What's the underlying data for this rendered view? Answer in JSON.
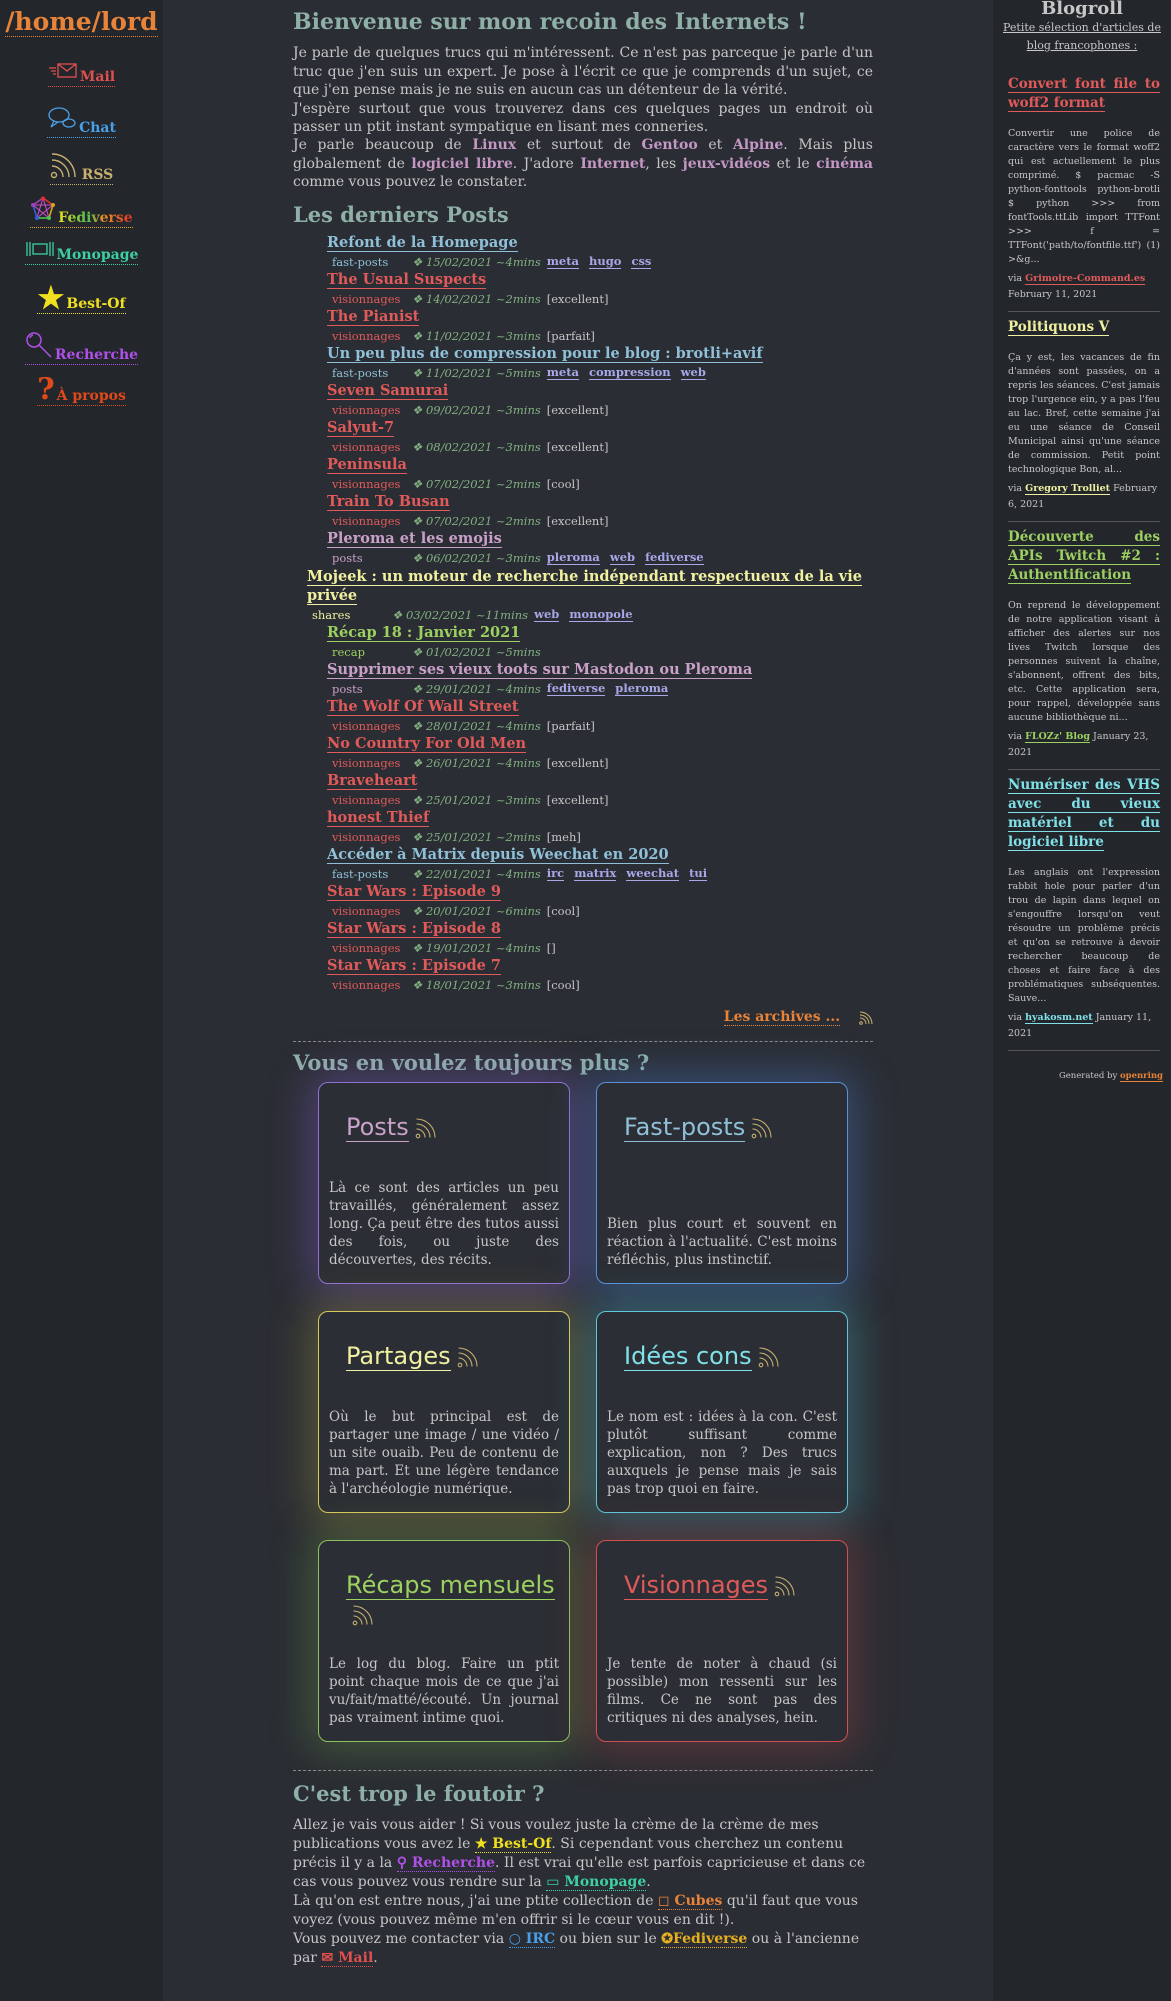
{
  "site": {
    "title": "/home/lord"
  },
  "nav": [
    {
      "label": "Mail",
      "color": "#e05050",
      "icon": "mail-icon"
    },
    {
      "label": "Chat",
      "color": "#4aa0e8",
      "icon": "chat-icon"
    },
    {
      "label": "RSS",
      "color": "#c8b070",
      "icon": "rss-icon"
    },
    {
      "label": "Fediverse",
      "color": "#e8b020",
      "icon": "fediverse-icon"
    },
    {
      "label": "Monopage",
      "color": "#3ed0a0",
      "icon": "monopage-icon"
    },
    {
      "label": "Best-Of",
      "color": "#f0e020",
      "icon": "star-icon"
    },
    {
      "label": "Recherche",
      "color": "#b050e8",
      "icon": "search-icon"
    },
    {
      "label": "À propos",
      "color": "#e04a1a",
      "icon": "question-icon"
    }
  ],
  "main": {
    "welcome_title": "Bienvenue sur mon recoin des Internets !",
    "intro": {
      "p1": "Je parle de quelques trucs qui m'intéressent. Ce n'est pas parceque je parle d'un truc que j'en suis un expert. Je pose à l'écrit ce que je comprends d'un sujet, ce que j'en pense mais je ne suis en aucun cas un détenteur de la vérité.",
      "p2": "J'espère surtout que vous trouverez dans ces quelques pages un endroit où passer un ptit instant sympatique en lisant mes conneries.",
      "p3_a": "Je parle beaucoup de ",
      "linux": "Linux",
      "p3_b": " et surtout de ",
      "gentoo": "Gentoo",
      "p3_c": " et ",
      "alpine": "Alpine",
      "p3_d": ". Mais plus globalement de ",
      "logiciel_libre": "logiciel libre",
      "p3_e": ". J'adore ",
      "internet": "Internet",
      "p3_f": ", les ",
      "jeux": "jeux-vidéos",
      "p3_g": " et le ",
      "cinema": "cinéma",
      "p3_h": " comme vous pouvez le constater."
    },
    "posts_title": "Les derniers Posts",
    "posts": [
      {
        "title": "Refont de la Homepage",
        "category": "fast-posts",
        "date": "❖ 15/02/2021 ~4mins",
        "tags": [
          "meta",
          "hugo",
          "css"
        ],
        "rating": "",
        "color": "#8fc0d8"
      },
      {
        "title": "The Usual Suspects",
        "category": "visionnages",
        "date": "❖ 14/02/2021 ~2mins",
        "tags": [],
        "rating": "[excellent]",
        "color": "#e05a5a"
      },
      {
        "title": "The Pianist",
        "category": "visionnages",
        "date": "❖ 11/02/2021 ~3mins",
        "tags": [],
        "rating": "[parfait]",
        "color": "#e05a5a"
      },
      {
        "title": "Un peu plus de compression pour le blog : brotli+avif",
        "category": "fast-posts",
        "date": "❖ 11/02/2021 ~5mins",
        "tags": [
          "meta",
          "compression",
          "web"
        ],
        "rating": "",
        "color": "#8fc0d8"
      },
      {
        "title": "Seven Samurai",
        "category": "visionnages",
        "date": "❖ 09/02/2021 ~3mins",
        "tags": [],
        "rating": "[excellent]",
        "color": "#e05a5a"
      },
      {
        "title": "Salyut-7",
        "category": "visionnages",
        "date": "❖ 08/02/2021 ~3mins",
        "tags": [],
        "rating": "[excellent]",
        "color": "#e05a5a"
      },
      {
        "title": "Peninsula",
        "category": "visionnages",
        "date": "❖ 07/02/2021 ~2mins",
        "tags": [],
        "rating": "[cool]",
        "color": "#e05a5a"
      },
      {
        "title": "Train To Busan",
        "category": "visionnages",
        "date": "❖ 07/02/2021 ~2mins",
        "tags": [],
        "rating": "[excellent]",
        "color": "#e05a5a"
      },
      {
        "title": "Pleroma et les emojis",
        "category": "posts",
        "date": "❖ 06/02/2021 ~3mins",
        "tags": [
          "pleroma",
          "web",
          "fediverse"
        ],
        "rating": "",
        "color": "#c8a0c8"
      },
      {
        "title": "Mojeek : un moteur de recherche indépendant respectueux de la vie privée",
        "category": "shares",
        "date": "❖ 03/02/2021 ~11mins",
        "tags": [
          "web",
          "monopole"
        ],
        "rating": "",
        "color": "#f0f0a0",
        "shares": true
      },
      {
        "title": "Récap 18 : Janvier 2021",
        "category": "recap",
        "date": "❖ 01/02/2021 ~5mins",
        "tags": [],
        "rating": "",
        "color": "#9cd060"
      },
      {
        "title": "Supprimer ses vieux toots sur Mastodon ou Pleroma",
        "category": "posts",
        "date": "❖ 29/01/2021 ~4mins",
        "tags": [
          "fediverse",
          "pleroma"
        ],
        "rating": "",
        "color": "#c8a0c8"
      },
      {
        "title": "The Wolf Of Wall Street",
        "category": "visionnages",
        "date": "❖ 28/01/2021 ~4mins",
        "tags": [],
        "rating": "[parfait]",
        "color": "#e05a5a"
      },
      {
        "title": "No Country For Old Men",
        "category": "visionnages",
        "date": "❖ 26/01/2021 ~4mins",
        "tags": [],
        "rating": "[excellent]",
        "color": "#e05a5a"
      },
      {
        "title": "Braveheart",
        "category": "visionnages",
        "date": "❖ 25/01/2021 ~3mins",
        "tags": [],
        "rating": "[excellent]",
        "color": "#e05a5a"
      },
      {
        "title": "honest Thief",
        "category": "visionnages",
        "date": "❖ 25/01/2021 ~2mins",
        "tags": [],
        "rating": "[meh]",
        "color": "#e05a5a"
      },
      {
        "title": "Accéder à Matrix depuis Weechat en 2020",
        "category": "fast-posts",
        "date": "❖ 22/01/2021 ~4mins",
        "tags": [
          "irc",
          "matrix",
          "weechat",
          "tui"
        ],
        "rating": "",
        "color": "#8fc0d8"
      },
      {
        "title": "Star Wars : Episode 9",
        "category": "visionnages",
        "date": "❖ 20/01/2021 ~6mins",
        "tags": [],
        "rating": "[cool]",
        "color": "#e05a5a"
      },
      {
        "title": "Star Wars : Episode 8",
        "category": "visionnages",
        "date": "❖ 19/01/2021 ~4mins",
        "tags": [],
        "rating": "[]",
        "color": "#e05a5a"
      },
      {
        "title": "Star Wars : Episode 7",
        "category": "visionnages",
        "date": "❖ 18/01/2021 ~3mins",
        "tags": [],
        "rating": "[cool]",
        "color": "#e05a5a"
      }
    ],
    "archives_label": "Les archives ...",
    "more_title": "Vous en voulez toujours plus ?",
    "cards": [
      {
        "title": "Posts",
        "color": "#c8a0c8",
        "border": "#9070d0",
        "glow": "rgba(140,100,220,0.35)",
        "desc": "Là ce sont des articles un peu travaillés, généralement assez long. Ça peut être des tutos aussi des fois, ou juste des découvertes, des récits."
      },
      {
        "title": "Fast-posts",
        "color": "#8fc0d8",
        "border": "#5a90d8",
        "glow": "rgba(80,130,220,0.35)",
        "desc": "Bien plus court et souvent en réaction à l'actualité. C'est moins réfléchis, plus instinctif."
      },
      {
        "title": "Partages",
        "color": "#f0f0a0",
        "border": "#d8c860",
        "glow": "rgba(220,200,80,0.25)",
        "desc": "Où le but principal est de partager une image / une vidéo / un site ouaib. Peu de contenu de ma part. Et une légère tendance à l'archéologie numérique."
      },
      {
        "title": "Idées cons",
        "color": "#80e0e8",
        "border": "#60c8d8",
        "glow": "rgba(80,200,220,0.3)",
        "desc": "Le nom est : idées à la con. C'est plutôt suffisant comme explication, non ? Des trucs auxquels je pense mais je sais pas trop quoi en faire."
      },
      {
        "title": "Récaps mensuels",
        "color": "#9cd060",
        "border": "#8cc060",
        "glow": "rgba(140,200,80,0.25)",
        "desc": "Le log du blog. Faire un ptit point chaque mois de ce que j'ai vu/fait/matté/écouté. Un journal pas vraiment intime quoi."
      },
      {
        "title": "Visionnages",
        "color": "#e05a5a",
        "border": "#d05050",
        "glow": "rgba(220,80,80,0.25)",
        "desc": "Je tente de noter à chaud (si possible) mon ressenti sur les films. Ce ne sont pas des critiques ni des analyses, hein."
      }
    ],
    "foutoir": {
      "title": "C'est trop le foutoir ?",
      "l1": "Allez je vais vous aider ! Si vous voulez juste la crème de la crème de mes publications vous avez le ",
      "bestof": "Best-Of",
      "l2": ". Si cependant vous cherchez un contenu précis il y a la ",
      "recherche": "Recherche",
      "l3": ". Il est vrai qu'elle est parfois capricieuse et dans ce cas vous pouvez vous rendre sur la ",
      "monopage": "Monopage",
      "l4": ".",
      "l5": "Là qu'on est entre nous, j'ai une ptite collection de ",
      "cubes": "Cubes",
      "l6": " qu'il faut que vous voyez (vous pouvez même m'en offrir si le cœur vous en dit !).",
      "l7": "Vous pouvez me contacter via ",
      "irc": "IRC",
      "l8": " ou bien sur le ",
      "fediverse": "Fediverse",
      "l9": " ou à l'ancienne par ",
      "mail": "Mail",
      "l10": "."
    }
  },
  "blogroll": {
    "title": "Blogroll",
    "subtitle": "Petite sélection d'articles de blog francophones :",
    "entries": [
      {
        "title": "Convert font file to woff2 format",
        "color": "#e05a5a",
        "body": "Convertir une police de caractère vers le format woff2 qui est actuellement le plus comprimé. $ pacmac -S python-fonttools python-brotli $ python >>> from fontTools.ttLib import TTFont >>> f = TTFont('path/to/fontfile.ttf') (1) >&g...",
        "via": "via",
        "source": "Grimoire-Command.es",
        "date": "February 11, 2021"
      },
      {
        "title": "Politiquons V",
        "color": "#f0f0a0",
        "body": "Ça y est, les vacances de fin d'années sont passées, on a repris les séances. C'est jamais trop l'urgence ein, y a pas l'feu au lac. Bref, cette semaine j'ai eu une séance de Conseil Municipal ainsi qu'une séance de commission. Petit point technologique Bon, al...",
        "via": "via",
        "source": "Gregory Trolliet",
        "date": "February 6, 2021"
      },
      {
        "title": "Découverte des APIs Twitch #2 : Authentification",
        "color": "#9cd060",
        "body": "On reprend le développement de notre application visant à afficher des alertes sur nos lives Twitch lorsque des personnes suivent la chaîne, s'abonnent, offrent des bits, etc. Cette application sera, pour rappel, développée sans aucune bibliothèque ni...",
        "via": "via",
        "source": "FLOZz' Blog",
        "date": "January 23, 2021"
      },
      {
        "title": "Numériser des VHS avec du vieux matériel et du logiciel libre",
        "color": "#80e0e8",
        "body": "Les anglais ont l'expression rabbit hole pour parler d'un trou de lapin dans lequel on s'engouffre lorsqu'on veut résoudre un problème précis et qu'on se retrouve à devoir rechercher beaucoup de choses et faire face à des problématiques subséquentes. Sauve...",
        "via": "via",
        "source": "hyakosm.net",
        "date": "January 11, 2021"
      }
    ],
    "generated_prefix": "Generated by",
    "generated_link": "openring"
  },
  "colors": {
    "bg": "#2a2d33",
    "sidebar": "#23262b",
    "accent": "#e8833a",
    "heading": "#8fb0a6"
  }
}
